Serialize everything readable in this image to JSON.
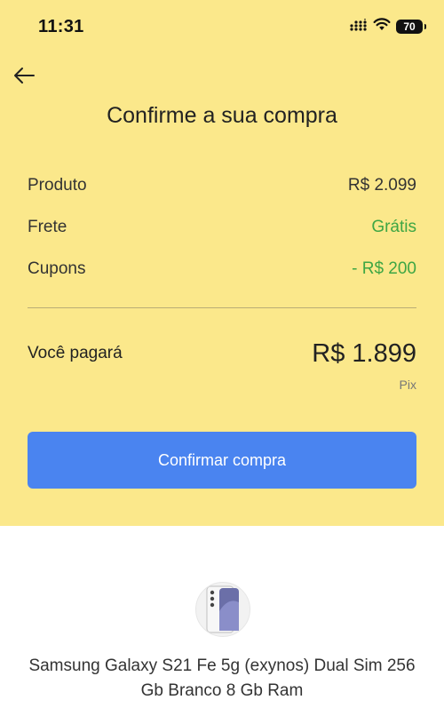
{
  "status_bar": {
    "time": "11:31",
    "battery": "70"
  },
  "header": {
    "title": "Confirme a sua compra"
  },
  "summary": {
    "rows": [
      {
        "label": "Produto",
        "value": "R$ 2.099"
      },
      {
        "label": "Frete",
        "value": "Grátis"
      },
      {
        "label": "Cupons",
        "value": "- R$ 200"
      }
    ],
    "total_label": "Você pagará",
    "total_value": "R$ 1.899",
    "payment_method": "Pix"
  },
  "confirm_button_label": "Confirmar compra",
  "product": {
    "name": "Samsung Galaxy S21 Fe 5g (exynos) Dual Sim 256 Gb Branco 8 Gb Ram"
  },
  "colors": {
    "panel_background": "#fbe88b",
    "primary_button": "#4a84f0",
    "positive_green": "#3ea644"
  },
  "icons": {
    "back": "arrow-left-icon",
    "signal": "cellular-signal-icon",
    "wifi": "wifi-icon",
    "battery": "battery-icon"
  }
}
